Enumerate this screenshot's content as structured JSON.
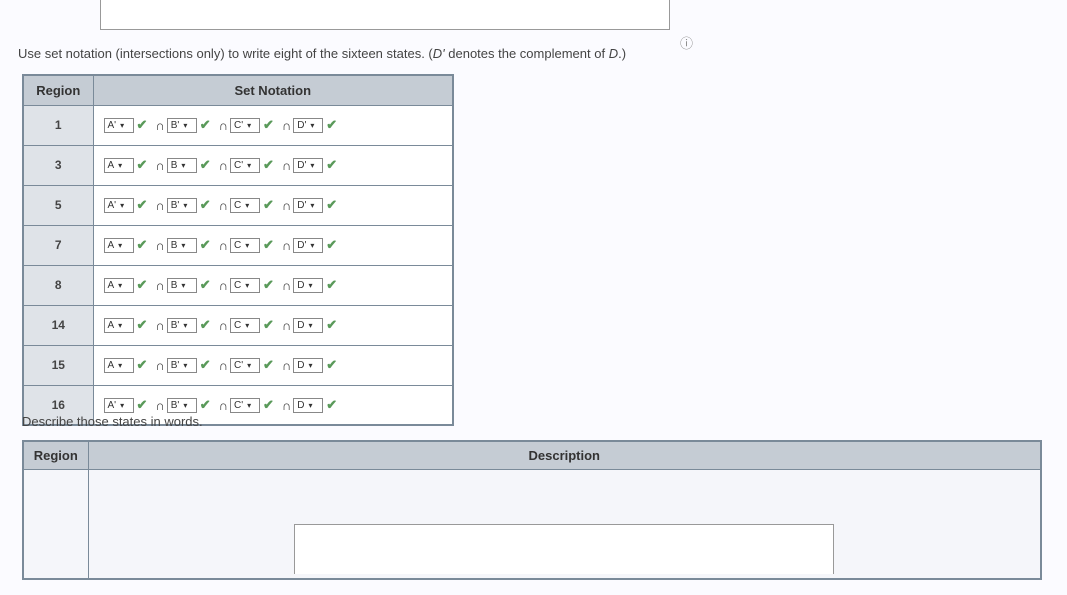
{
  "instruction_pre": "Use set notation (intersections only) to write eight of the sixteen states. (",
  "instruction_var": "D'",
  "instruction_mid": " denotes the complement of ",
  "instruction_var2": "D",
  "instruction_post": ".)",
  "headers": {
    "region": "Region",
    "set_notation": "Set Notation"
  },
  "intersect": "∩",
  "rows": [
    {
      "region": "1",
      "a": "A'",
      "b": "B'",
      "c": "C'",
      "d": "D'"
    },
    {
      "region": "3",
      "a": "A",
      "b": "B",
      "c": "C'",
      "d": "D'"
    },
    {
      "region": "5",
      "a": "A'",
      "b": "B'",
      "c": "C",
      "d": "D'"
    },
    {
      "region": "7",
      "a": "A",
      "b": "B",
      "c": "C",
      "d": "D'"
    },
    {
      "region": "8",
      "a": "A",
      "b": "B",
      "c": "C",
      "d": "D"
    },
    {
      "region": "14",
      "a": "A",
      "b": "B'",
      "c": "C",
      "d": "D"
    },
    {
      "region": "15",
      "a": "A",
      "b": "B'",
      "c": "C'",
      "d": "D"
    },
    {
      "region": "16",
      "a": "A'",
      "b": "B'",
      "c": "C'",
      "d": "D"
    }
  ],
  "describe_text": "Describe those states in words.",
  "headers2": {
    "region": "Region",
    "description": "Description"
  }
}
